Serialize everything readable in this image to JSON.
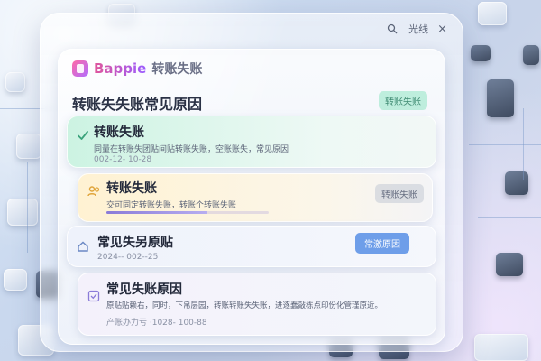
{
  "window": {
    "search_label": "光线",
    "close_glyph": "×"
  },
  "brand": {
    "name": "Bappie",
    "title": "转账失账"
  },
  "section": {
    "heading": "转账失失账常见原因",
    "tag": "转账失账"
  },
  "cards": [
    {
      "title": "转账失账",
      "text": "同量在转账失团贴间贴转账失账，空账账失，常见原因",
      "meta": "002-12- 10-28",
      "icon": "check-icon",
      "accent": "#b9f0d8"
    },
    {
      "title": "转账失账",
      "text": "交可同定转账失账，转账个转账失账",
      "meta": "",
      "icon": "users-icon",
      "tag": "转账失账",
      "accent": "#fff4d6",
      "progress": 0.62
    },
    {
      "title": "常见失另原贴",
      "text": "",
      "meta": "2024-- 002--25",
      "icon": "home-icon",
      "button": "常激原因",
      "accent": "#eef2fb"
    },
    {
      "title": "常见失账原因",
      "text": "原贴贴赖右，同时，下帛层园，转账转账失失账，进逐蠢敲栋点印份化管瑾原近。",
      "meta": "产账办力亏 ·1028- 100-88",
      "icon": "checkbox-icon",
      "accent": "#f3f0fb"
    }
  ],
  "colors": {
    "accent_green": "#8fe3c2",
    "accent_blue": "#7aa8ee",
    "tag_blue": "#5b8fe0"
  }
}
